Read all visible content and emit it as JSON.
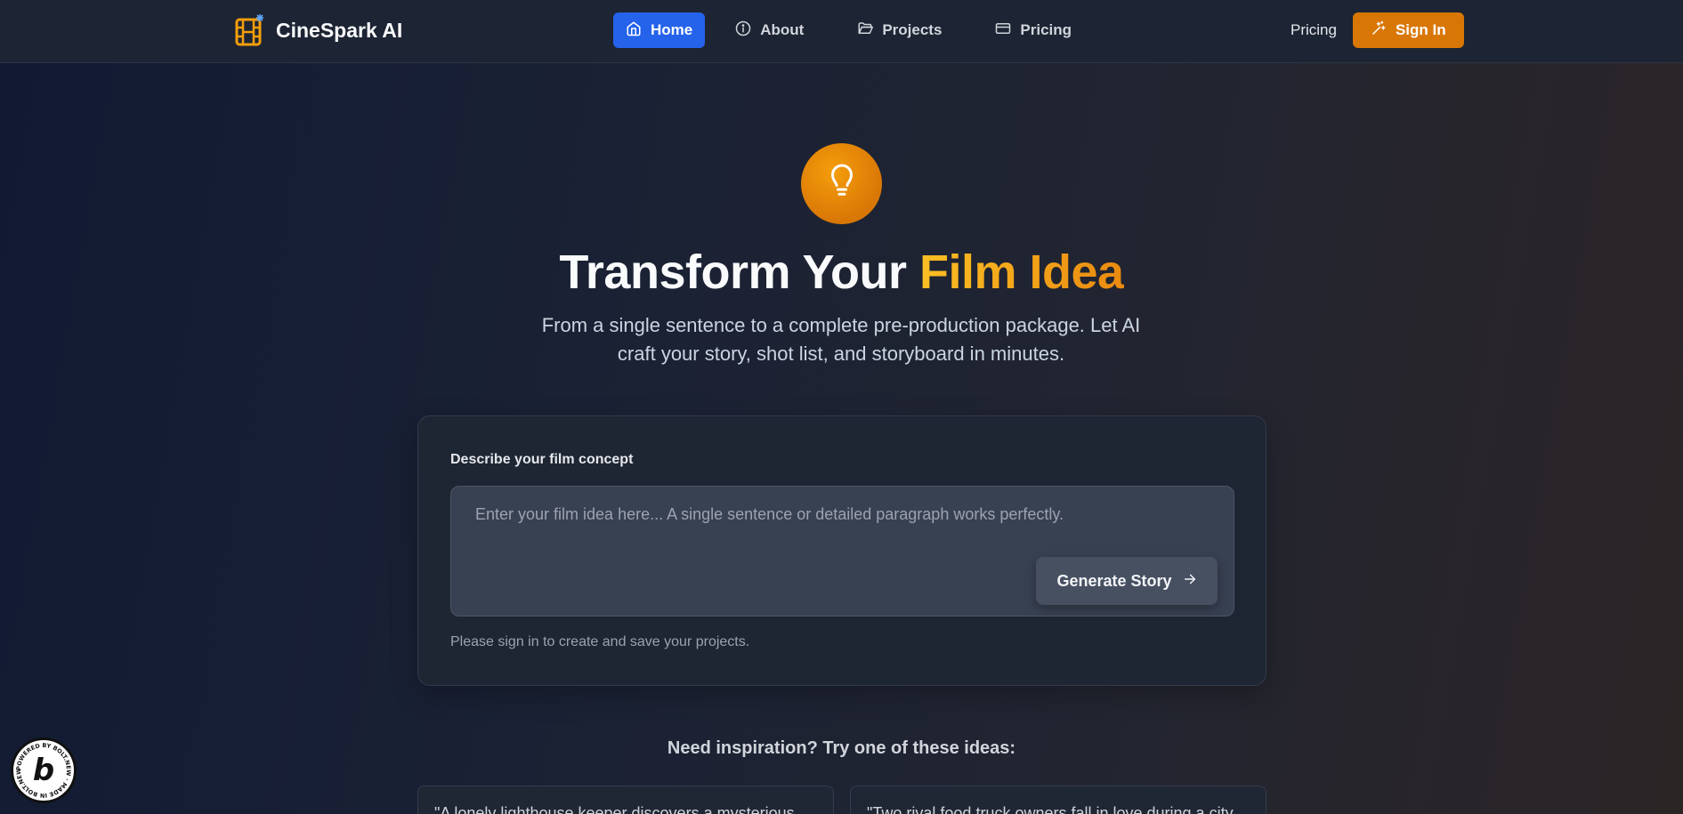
{
  "brand": {
    "name": "CineSpark AI"
  },
  "nav": {
    "items": [
      {
        "label": "Home",
        "icon": "home-icon",
        "active": true
      },
      {
        "label": "About",
        "icon": "info-icon",
        "active": false
      },
      {
        "label": "Projects",
        "icon": "folder-icon",
        "active": false
      },
      {
        "label": "Pricing",
        "icon": "credit-card-icon",
        "active": false
      }
    ],
    "pricing_link": "Pricing",
    "sign_in": "Sign In"
  },
  "hero": {
    "title_main": "Transform Your",
    "title_accent": "Film Idea",
    "subtitle": "From a single sentence to a complete pre-production package. Let AI craft your story, shot list, and storyboard in minutes."
  },
  "form": {
    "label": "Describe your film concept",
    "placeholder": "Enter your film idea here... A single sentence or detailed paragraph works perfectly.",
    "button": "Generate Story",
    "note": "Please sign in to create and save your projects."
  },
  "inspiration": {
    "title": "Need inspiration? Try one of these ideas:",
    "ideas": [
      "\"A lonely lighthouse keeper discovers a mysterious",
      "\"Two rival food truck owners fall in love during a city"
    ]
  },
  "badge": {
    "ring_text": "POWERED BY BOLT.NEW · MADE IN BOLT.NEW ·",
    "letter": "b"
  },
  "colors": {
    "accent_blue": "#2563eb",
    "accent_orange": "#d97706",
    "gold": "#fbbf24"
  }
}
